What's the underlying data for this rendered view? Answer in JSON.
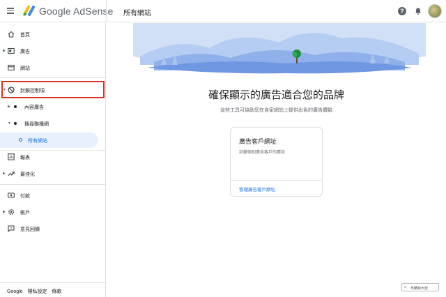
{
  "header": {
    "brand": "Google AdSense",
    "page_title": "所有網站",
    "help_glyph": "?"
  },
  "sidebar": {
    "items": [
      {
        "label": "首頁",
        "icon": "home-icon"
      },
      {
        "label": "廣告",
        "icon": "ads-icon"
      },
      {
        "label": "網站",
        "icon": "sites-icon"
      },
      {
        "label": "封鎖控制項",
        "icon": "block-icon"
      },
      {
        "label": "內容廣告",
        "icon": "dot-icon"
      },
      {
        "label": "搜尋聯播網",
        "icon": "dot-icon"
      },
      {
        "label": "所有網站",
        "icon": "ring-icon"
      },
      {
        "label": "報表",
        "icon": "reports-icon"
      },
      {
        "label": "最佳化",
        "icon": "optimize-icon"
      },
      {
        "label": "付款",
        "icon": "payments-icon"
      },
      {
        "label": "帳戶",
        "icon": "account-gear-icon"
      },
      {
        "label": "意見回饋",
        "icon": "feedback-icon"
      }
    ],
    "footer": [
      "Google",
      "隱私設定",
      "條款"
    ]
  },
  "main": {
    "headline": "確保顯示的廣告適合您的品牌",
    "subhead": "這些工具可協助您在自家網站上提供出色的廣告體驗",
    "card": {
      "title": "廣告客戶網址",
      "description": "封鎖個別廣告客戶的廣告",
      "link": "管理廣告客戶網址"
    }
  },
  "watermark": "布蘭特大叔",
  "colors": {
    "accent": "#1a73e8",
    "highlight_border": "#d93025",
    "active_bg": "#e8f0fe",
    "banner_blue": "#8fb0ea"
  }
}
